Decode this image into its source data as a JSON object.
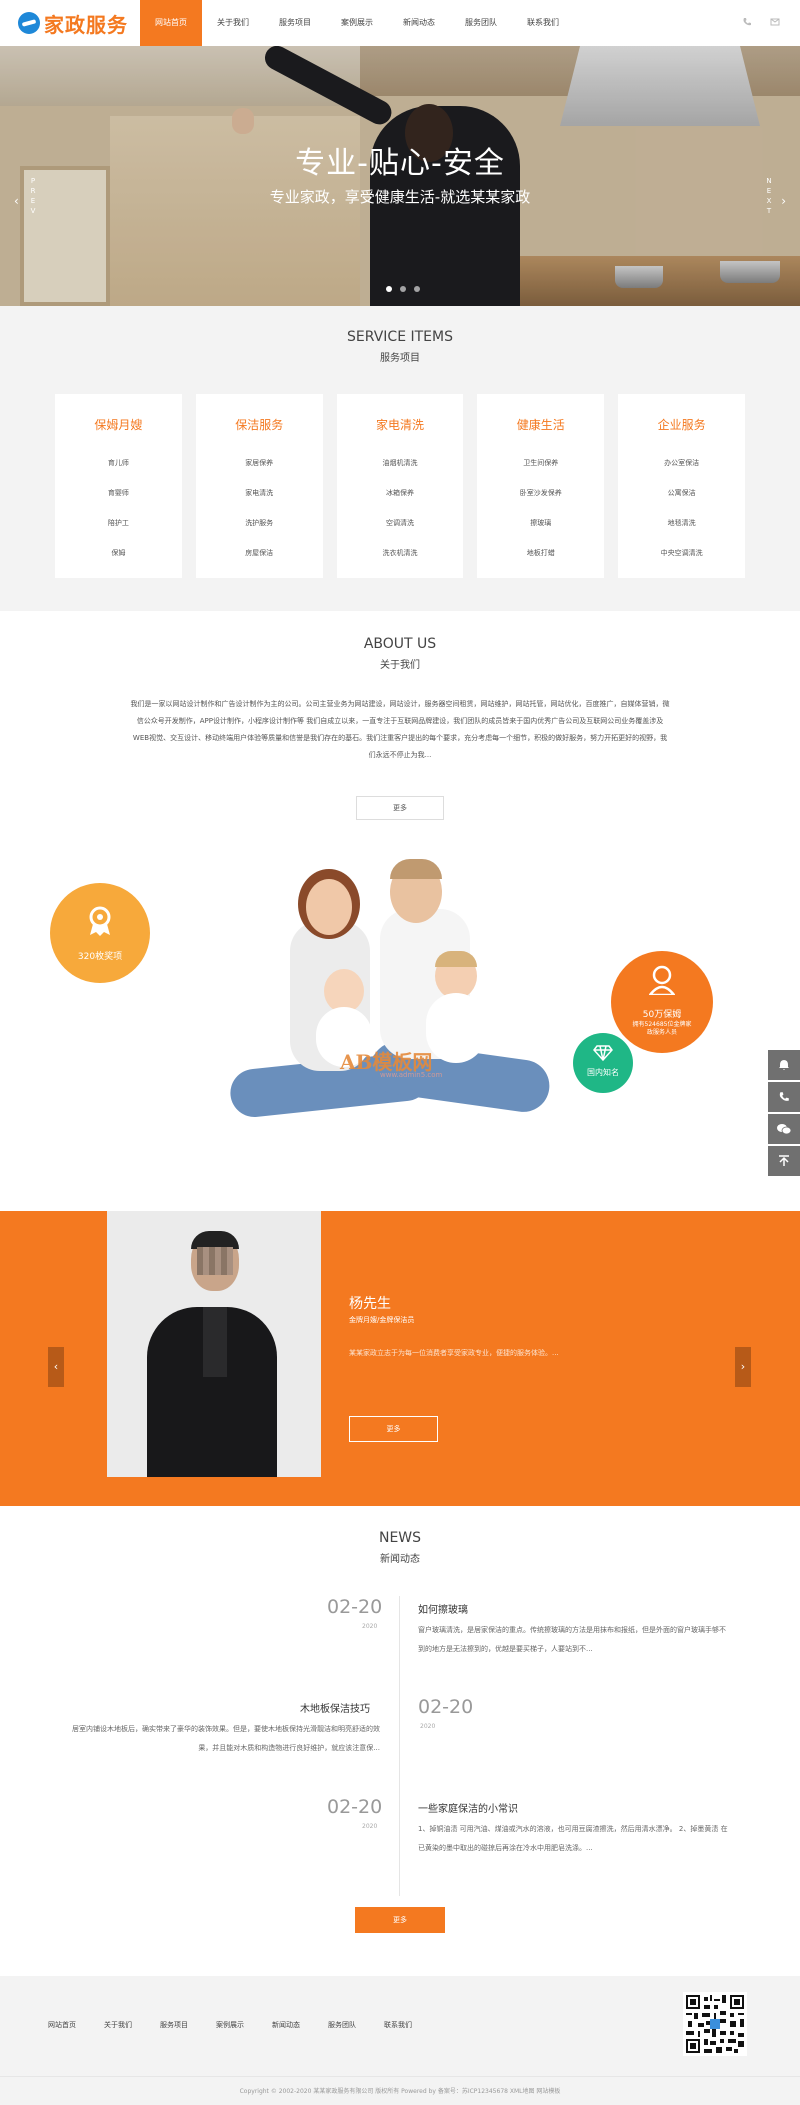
{
  "header": {
    "logo_text": "家政服务",
    "nav": [
      "网站首页",
      "关于我们",
      "服务项目",
      "案例展示",
      "新闻动态",
      "服务团队",
      "联系我们"
    ],
    "active_nav": 0,
    "icons": [
      "phone-icon",
      "mail-icon"
    ]
  },
  "banner": {
    "title": "专业-贴心-安全",
    "subtitle": "专业家政，享受健康生活-就选某某家政",
    "prev_label": "PREV",
    "next_label": "NEXT",
    "slides": 3,
    "active_slide": 0
  },
  "services": {
    "title_en": "SERVICE ITEMS",
    "title_zh": "服务项目",
    "categories": [
      {
        "title": "保姆月嫂",
        "items": [
          "育儿师",
          "育婴师",
          "陪护工",
          "保姆"
        ]
      },
      {
        "title": "保洁服务",
        "items": [
          "家居保养",
          "家电清洗",
          "洗护服务",
          "房屋保洁"
        ]
      },
      {
        "title": "家电清洗",
        "items": [
          "油烟机清洗",
          "冰箱保养",
          "空调清洗",
          "洗衣机清洗"
        ]
      },
      {
        "title": "健康生活",
        "items": [
          "卫生间保养",
          "卧室沙发保养",
          "擦玻璃",
          "地板打蜡"
        ]
      },
      {
        "title": "企业服务",
        "items": [
          "办公室保洁",
          "公寓保洁",
          "地毯清洗",
          "中央空调清洗"
        ]
      }
    ]
  },
  "about": {
    "title_en": "ABOUT US",
    "title_zh": "关于我们",
    "text": "我们是一家以网站设计制作和广告设计制作为主的公司。公司主营业务为网站建设，网站设计，服务器空间租赁，网站维护，网站托管，网站优化，百度推广，自媒体营销，微信公众号开发制作，APP设计制作，小程序设计制作等 我们自成立以来，一直专注于互联网品牌建设，我们团队的成员皆来于国内优秀广告公司及互联网公司业务覆盖涉及WEB视觉、交互设计、移动终端用户体验等质量和信誉是我们存在的基石。我们注重客户提出的每个要求，充分考虑每一个细节，积极的做好服务，努力开拓更好的视野，我们永远不停止为我...",
    "more_label": "更多",
    "badge_left": "320枚奖项",
    "badge_right_title": "50万保姆",
    "badge_right_desc": "拥有524685位金牌家政服务人员",
    "badge_green": "国内知名",
    "watermark": "AB模板网",
    "watermark_sub": "www.admin5.com"
  },
  "side_tools": [
    "bell-icon",
    "phone-icon",
    "wechat-icon",
    "back-to-top-icon"
  ],
  "team": {
    "name": "杨先生",
    "role": "金牌月嫂/金牌保洁员",
    "desc": "某某家政立志于为每一位消费者享受家政专业，便捷的服务体验。...",
    "more_label": "更多"
  },
  "news": {
    "title_en": "NEWS",
    "title_zh": "新闻动态",
    "items": [
      {
        "date": "02-20",
        "year": "2020",
        "title": "如何擦玻璃",
        "desc": "窗户玻璃清洗，是居家保洁的重点。传统擦玻璃的方法是用抹布和报纸，但是外面的窗户玻璃手够不到的地方是无法擦到的，优越是要买梯子，人要站到不..."
      },
      {
        "date": "02-20",
        "year": "2020",
        "title": "木地板保洁技巧",
        "desc": "居室内铺设木地板后，确实带来了豪华的装饰效果。但是，要使木地板保持光滑靓洁和明亮舒适的效果，并且能对木质和构造物进行良好维护，就应该注意保..."
      },
      {
        "date": "02-20",
        "year": "2020",
        "title": "一些家庭保洁的小常识",
        "desc": "1、掉铜油渍 可用汽油、煤油或汽水的溶液，也可用豆腐渣擦洗，然后用清水漂净。 2、掉墨黄渍 在已黄染的墨中取出的碰掠后再涂在冷水中用肥皂洗涤。..."
      }
    ],
    "more_label": "更多"
  },
  "footer": {
    "links": [
      "网站首页",
      "关于我们",
      "服务项目",
      "案例展示",
      "新闻动态",
      "服务团队",
      "联系我们"
    ],
    "copyright": "Copyright © 2002-2020 某某家政服务有限公司 版权所有 Powered by 备案号：苏ICP12345678 XML地图 网站模板"
  }
}
